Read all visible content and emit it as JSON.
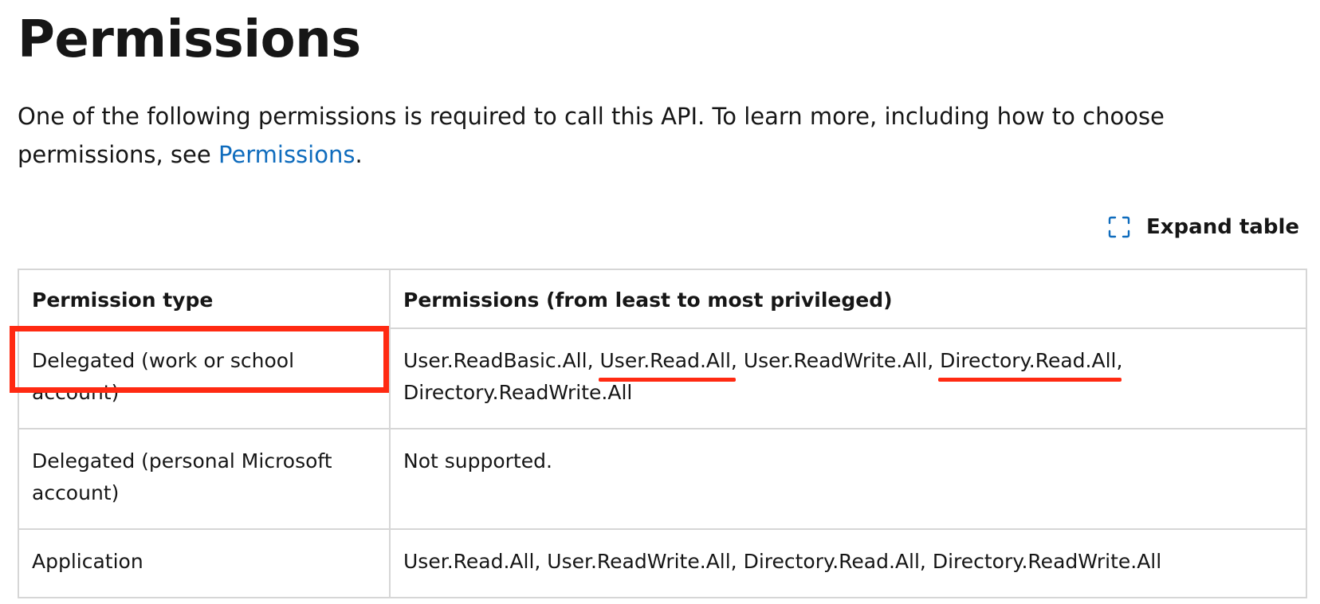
{
  "page": {
    "title": "Permissions",
    "intro_before": "One of the following permissions is required to call this API. To learn more, including how to choose permissions, see ",
    "intro_link": "Permissions",
    "intro_after": "."
  },
  "expand": {
    "icon": "expand-icon",
    "label": "Expand table"
  },
  "table": {
    "headers": [
      "Permission type",
      "Permissions (from least to most privileged)"
    ],
    "rows": [
      {
        "type": "Delegated (work or school account)",
        "perms": {
          "p1": "User.ReadBasic.All",
          "sep1": ", ",
          "p2": "User.Read.All",
          "sep2": ", ",
          "p3": "User.ReadWrite.All",
          "sep3": ", ",
          "p4": "Directory.Read.All",
          "sep4": ", ",
          "p5": "Directory.ReadWrite.All"
        }
      },
      {
        "type": "Delegated (personal Microsoft account)",
        "perms_text": "Not supported."
      },
      {
        "type": "Application",
        "perms_text": "User.Read.All, User.ReadWrite.All, Directory.Read.All, Directory.ReadWrite.All"
      }
    ]
  },
  "colors": {
    "link": "#0f6cbd",
    "annotation": "#ff2a12",
    "border": "#d6d6d6"
  }
}
